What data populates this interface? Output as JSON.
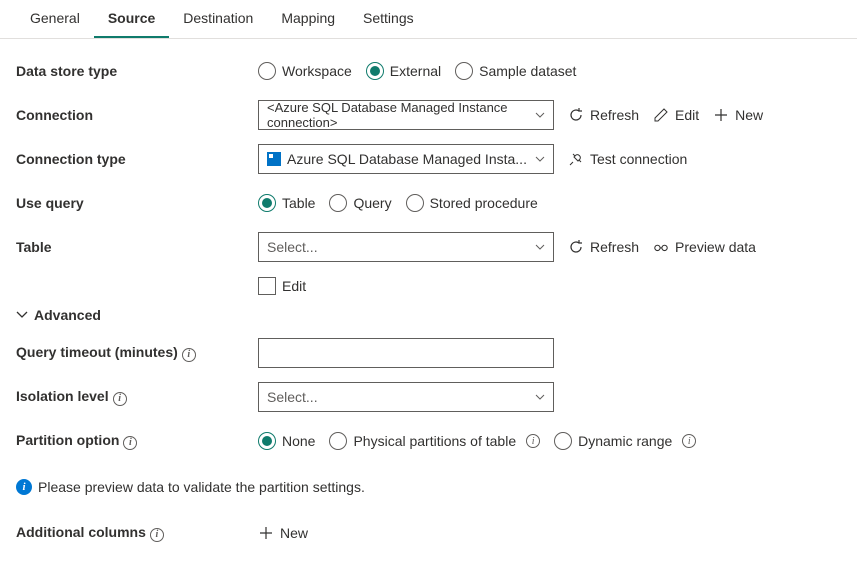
{
  "tabs": [
    "General",
    "Source",
    "Destination",
    "Mapping",
    "Settings"
  ],
  "active_tab": 1,
  "labels": {
    "data_store_type": "Data store type",
    "connection": "Connection",
    "connection_type": "Connection type",
    "use_query": "Use query",
    "table": "Table",
    "advanced": "Advanced",
    "query_timeout": "Query timeout (minutes)",
    "isolation_level": "Isolation level",
    "partition_option": "Partition option",
    "additional_columns": "Additional columns"
  },
  "data_store_type": {
    "options": [
      "Workspace",
      "External",
      "Sample dataset"
    ],
    "selected": "External"
  },
  "connection": {
    "value": "<Azure SQL Database Managed Instance connection>",
    "actions": {
      "refresh": "Refresh",
      "edit": "Edit",
      "new": "New"
    }
  },
  "connection_type": {
    "value": "Azure SQL Database Managed Insta...",
    "actions": {
      "test": "Test connection"
    }
  },
  "use_query": {
    "options": [
      "Table",
      "Query",
      "Stored procedure"
    ],
    "selected": "Table"
  },
  "table": {
    "placeholder": "Select...",
    "edit_label": "Edit",
    "actions": {
      "refresh": "Refresh",
      "preview": "Preview data"
    }
  },
  "query_timeout": {
    "value": ""
  },
  "isolation_level": {
    "placeholder": "Select..."
  },
  "partition_option": {
    "options": [
      "None",
      "Physical partitions of table",
      "Dynamic range"
    ],
    "selected": "None"
  },
  "info_message": "Please preview data to validate the partition settings.",
  "additional_columns": {
    "new": "New"
  }
}
